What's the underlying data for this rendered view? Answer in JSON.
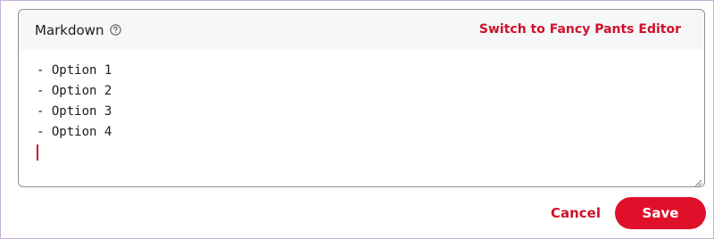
{
  "editor": {
    "mode_label": "Markdown",
    "help_icon": "question-circle-icon",
    "switch_link": "Switch to Fancy Pants Editor",
    "lines": [
      "- Option 1",
      "- Option 2",
      "- Option 3",
      "- Option 4"
    ]
  },
  "actions": {
    "cancel_label": "Cancel",
    "save_label": "Save"
  },
  "colors": {
    "accent": "#e0102b",
    "link": "#d0112b",
    "header_bg": "#f6f7f8",
    "border": "#8f8f8f"
  }
}
